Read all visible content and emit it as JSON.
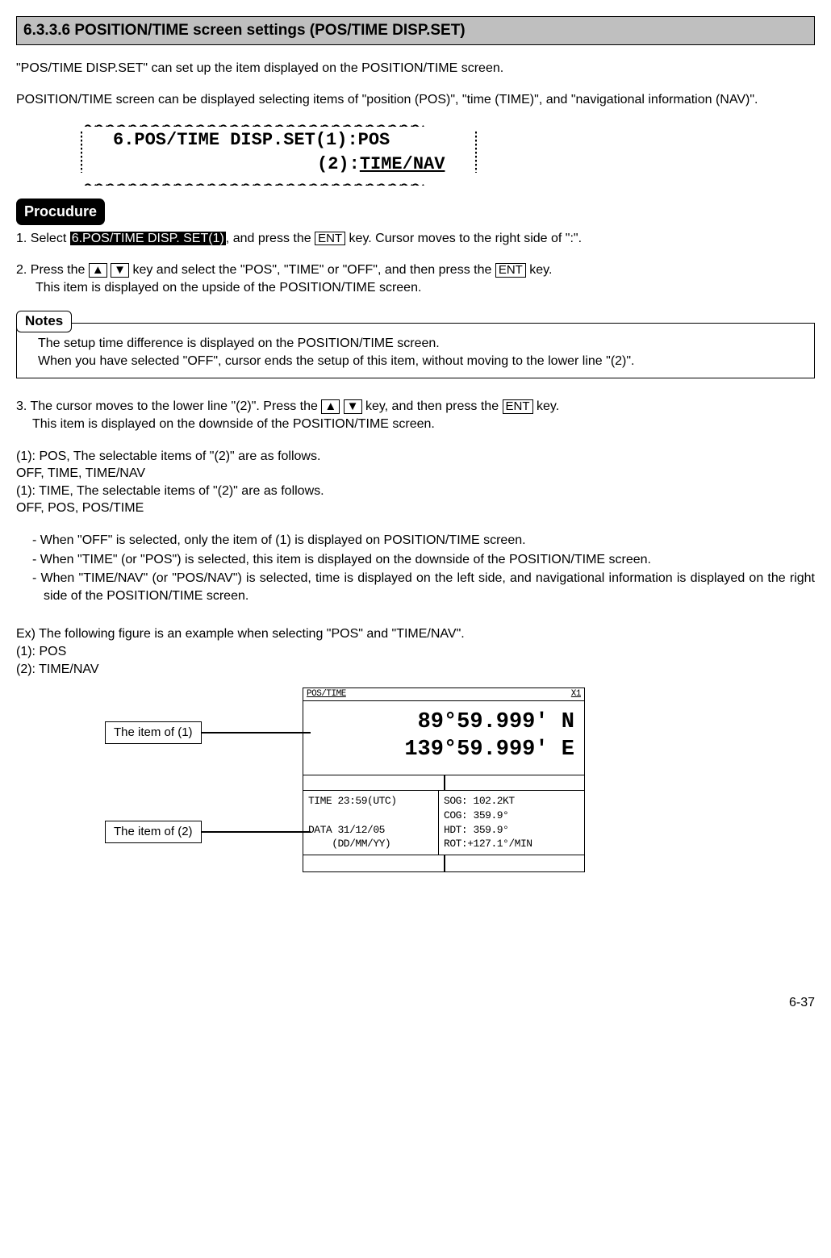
{
  "section_header": "6.3.3.6 POSITION/TIME screen settings (POS/TIME DISP.SET)",
  "intro": {
    "p1": "\"POS/TIME DISP.SET\" can set up the item displayed on the POSITION/TIME screen.",
    "p2": "POSITION/TIME screen can be displayed selecting items of \"position (POS)\", \"time (TIME)\", and \"navigational information (NAV)\"."
  },
  "menu": {
    "line1": "6.POS/TIME DISP.SET(1):POS",
    "line2_prefix": "(2):",
    "line2_value": "TIME/NAV"
  },
  "procedure_label": "Procudure",
  "step1": {
    "prefix": "1. Select ",
    "highlight": "6.POS/TIME DISP. SET(1)",
    "mid1": ", and press the ",
    "key1": "ENT",
    "suffix": " key. Cursor moves to the right side of \":\"."
  },
  "step2": {
    "prefix": "2. Press the ",
    "key_up": "▲",
    "key_down": "▼",
    "mid1": " key and select the \"POS\", \"TIME\" or \"OFF\", and then press the ",
    "key_ent": "ENT",
    "suffix": " key.",
    "sub": "This item is displayed on the upside of the POSITION/TIME screen."
  },
  "notes": {
    "label": "Notes",
    "line1": "The setup time difference is displayed on the POSITION/TIME screen.",
    "line2": "When you have selected \"OFF\", cursor ends the setup of this item, without moving to the lower line \"(2)\"."
  },
  "step3": {
    "prefix": "3. The cursor moves to the lower line \"(2)\". Press the ",
    "key_up": "▲",
    "key_down": "▼",
    "mid1": " key, and then press the ",
    "key_ent": "ENT",
    "suffix": " key.",
    "sub": "This item is displayed on the downside of the POSITION/TIME screen.",
    "sel1a": "(1): POS, The selectable items of \"(2)\" are as follows.",
    "sel1b": "OFF, TIME, TIME/NAV",
    "sel2a": "(1): TIME, The selectable items of \"(2)\" are as follows.",
    "sel2b": "OFF, POS, POS/TIME",
    "dash1": "- When \"OFF\" is selected, only the item of (1) is displayed on POSITION/TIME screen.",
    "dash2": "- When \"TIME\" (or \"POS\") is selected, this item is displayed on the downside of the POSITION/TIME screen.",
    "dash3": "- When \"TIME/NAV\" (or \"POS/NAV\") is selected, time is displayed on the left side, and navigational information is displayed on the right side of the POSITION/TIME screen."
  },
  "example": {
    "intro": "Ex) The following figure is an example when selecting \"POS\" and \"TIME/NAV\".",
    "l1": "(1): POS",
    "l2": "(2): TIME/NAV",
    "callout1": "The item of (1)",
    "callout2": "The item of (2)",
    "screen": {
      "header_left": "POS/TIME",
      "header_right": "X1",
      "lat": " 89°59.999' N",
      "lon": "139°59.999' E",
      "nav_left": "TIME 23:59(UTC)\n\nDATA 31/12/05\n    (DD/MM/YY)",
      "nav_right": "SOG: 102.2KT\nCOG: 359.9°\nHDT: 359.9°\nROT:+127.1°/MIN"
    }
  },
  "page_number": "6-37"
}
